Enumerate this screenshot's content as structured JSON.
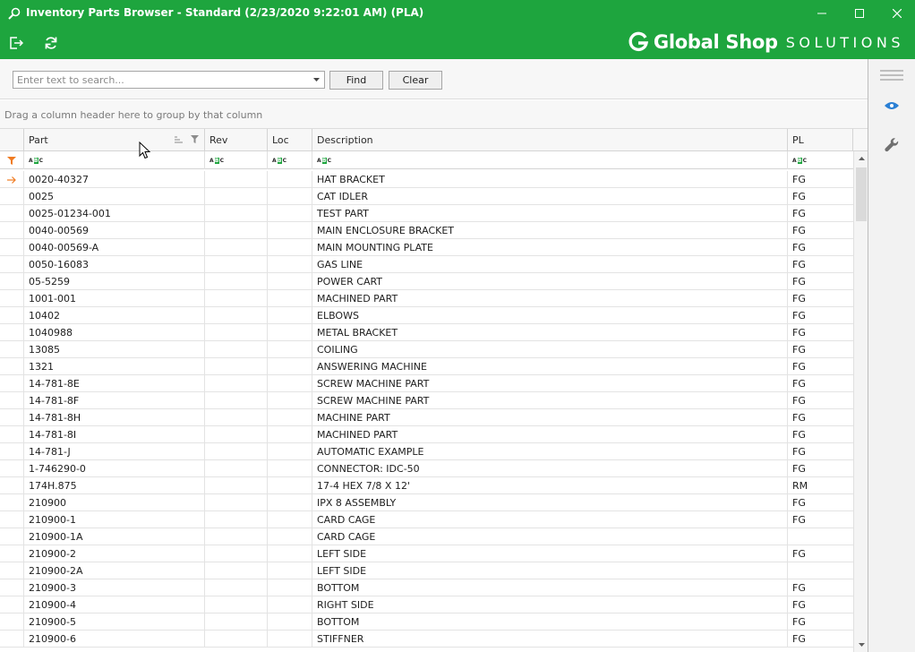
{
  "window": {
    "title": "Inventory Parts Browser - Standard (2/23/2020 9:22:01 AM) (PLA)"
  },
  "brand": {
    "name": "Global Shop",
    "suffix": "SOLUTIONS",
    "color": "#1ea53e"
  },
  "toolbar": {
    "exit_icon": "exit-icon",
    "refresh_icon": "refresh-icon"
  },
  "search": {
    "placeholder": "Enter text to search...",
    "value": "",
    "find_label": "Find",
    "clear_label": "Clear"
  },
  "grid": {
    "group_hint": "Drag a column header here to group by that column",
    "columns": {
      "part": "Part",
      "rev": "Rev",
      "loc": "Loc",
      "description": "Description",
      "pl": "PL"
    },
    "rows": [
      {
        "part": "0020-40327",
        "rev": "",
        "loc": "",
        "description": "HAT BRACKET",
        "pl": "FG",
        "current": true
      },
      {
        "part": "0025",
        "rev": "",
        "loc": "",
        "description": "CAT IDLER",
        "pl": "FG"
      },
      {
        "part": "0025-01234-001",
        "rev": "",
        "loc": "",
        "description": "TEST PART",
        "pl": "FG"
      },
      {
        "part": "0040-00569",
        "rev": "",
        "loc": "",
        "description": "MAIN ENCLOSURE BRACKET",
        "pl": "FG"
      },
      {
        "part": "0040-00569-A",
        "rev": "",
        "loc": "",
        "description": "MAIN MOUNTING PLATE",
        "pl": "FG"
      },
      {
        "part": "0050-16083",
        "rev": "",
        "loc": "",
        "description": "GAS LINE",
        "pl": "FG"
      },
      {
        "part": "05-5259",
        "rev": "",
        "loc": "",
        "description": "POWER CART",
        "pl": "FG"
      },
      {
        "part": "1001-001",
        "rev": "",
        "loc": "",
        "description": "MACHINED PART",
        "pl": "FG"
      },
      {
        "part": "10402",
        "rev": "",
        "loc": "",
        "description": "ELBOWS",
        "pl": "FG"
      },
      {
        "part": "1040988",
        "rev": "",
        "loc": "",
        "description": "METAL BRACKET",
        "pl": "FG"
      },
      {
        "part": "13085",
        "rev": "",
        "loc": "",
        "description": "COILING",
        "pl": "FG"
      },
      {
        "part": "1321",
        "rev": "",
        "loc": "",
        "description": "ANSWERING MACHINE",
        "pl": "FG"
      },
      {
        "part": "14-781-8E",
        "rev": "",
        "loc": "",
        "description": "SCREW MACHINE PART",
        "pl": "FG"
      },
      {
        "part": "14-781-8F",
        "rev": "",
        "loc": "",
        "description": "SCREW MACHINE PART",
        "pl": "FG"
      },
      {
        "part": "14-781-8H",
        "rev": "",
        "loc": "",
        "description": "MACHINE PART",
        "pl": "FG"
      },
      {
        "part": "14-781-8I",
        "rev": "",
        "loc": "",
        "description": "MACHINED PART",
        "pl": "FG"
      },
      {
        "part": "14-781-J",
        "rev": "",
        "loc": "",
        "description": "AUTOMATIC EXAMPLE",
        "pl": "FG"
      },
      {
        "part": "1-746290-0",
        "rev": "",
        "loc": "",
        "description": "CONNECTOR: IDC-50",
        "pl": "FG"
      },
      {
        "part": "174H.875",
        "rev": "",
        "loc": "",
        "description": "17-4 HEX 7/8 X 12'",
        "pl": "RM"
      },
      {
        "part": "210900",
        "rev": "",
        "loc": "",
        "description": "IPX 8 ASSEMBLY",
        "pl": "FG"
      },
      {
        "part": "210900-1",
        "rev": "",
        "loc": "",
        "description": "CARD CAGE",
        "pl": "FG"
      },
      {
        "part": "210900-1A",
        "rev": "",
        "loc": "",
        "description": "CARD CAGE",
        "pl": ""
      },
      {
        "part": "210900-2",
        "rev": "",
        "loc": "",
        "description": "LEFT SIDE",
        "pl": "FG"
      },
      {
        "part": "210900-2A",
        "rev": "",
        "loc": "",
        "description": "LEFT SIDE",
        "pl": ""
      },
      {
        "part": "210900-3",
        "rev": "",
        "loc": "",
        "description": "BOTTOM",
        "pl": "FG"
      },
      {
        "part": "210900-4",
        "rev": "",
        "loc": "",
        "description": "RIGHT SIDE",
        "pl": "FG"
      },
      {
        "part": "210900-5",
        "rev": "",
        "loc": "",
        "description": "BOTTOM",
        "pl": "FG"
      },
      {
        "part": "210900-6",
        "rev": "",
        "loc": "",
        "description": "STIFFNER",
        "pl": "FG"
      }
    ]
  },
  "side_panel": {
    "items": [
      "menu-icon",
      "eye-icon",
      "wrench-icon"
    ],
    "accent": "#2a7fd4"
  }
}
